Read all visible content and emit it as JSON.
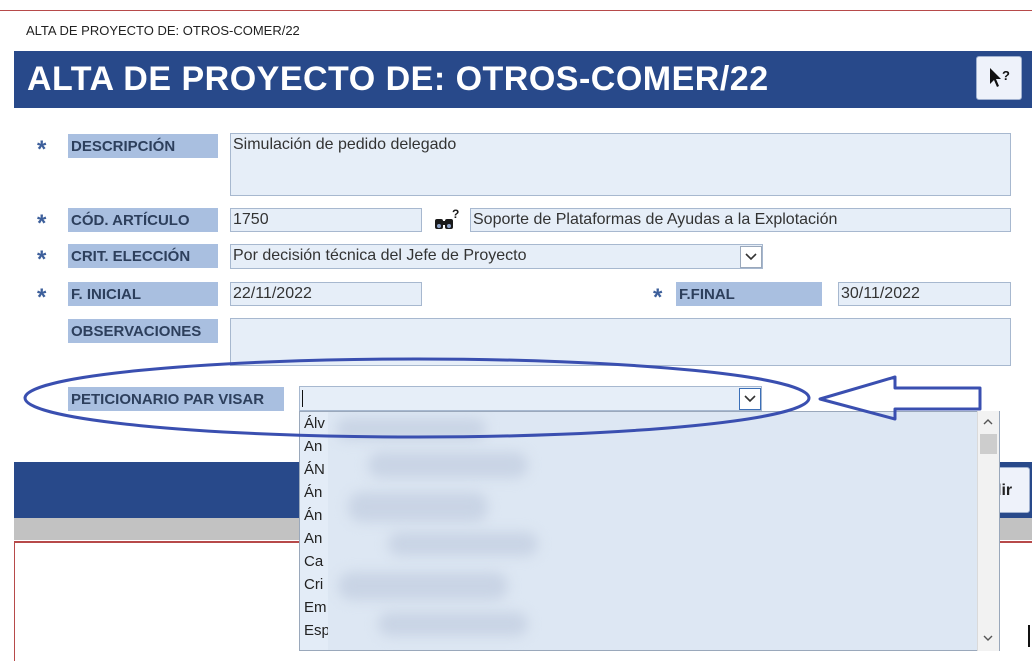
{
  "window": {
    "tab_title": "ALTA DE PROYECTO DE: OTROS-COMER/22"
  },
  "header": {
    "title": "ALTA DE PROYECTO DE: OTROS-COMER/22",
    "help_icon": "pointer-question-icon"
  },
  "form": {
    "required_mark": "*",
    "descripcion": {
      "label": "DESCRIPCIÓN",
      "value": "Simulación de pedido delegado"
    },
    "cod_articulo": {
      "label": "CÓD. ARTÍCULO",
      "value": "1750",
      "lookup_icon": "binoculars-question-icon",
      "description": "Soporte de Plataformas de Ayudas a la Explotación"
    },
    "crit_eleccion": {
      "label": "CRIT. ELECCIÓN",
      "value": "Por decisión técnica del Jefe de Proyecto"
    },
    "f_inicial": {
      "label": "F. INICIAL",
      "value": "22/11/2022"
    },
    "f_final": {
      "label": "F.FINAL",
      "value": "30/11/2022"
    },
    "observaciones": {
      "label": "OBSERVACIONES",
      "value": ""
    },
    "peticionario": {
      "label": "PETICIONARIO PAR VISAR",
      "value": ""
    }
  },
  "dropdown": {
    "items": [
      "Álv",
      "An",
      "ÁN",
      "Án",
      "Án",
      "An",
      "Ca",
      "Cri",
      "Em",
      "Esp"
    ]
  },
  "footer": {
    "exit_label": "lir"
  },
  "colors": {
    "header_bg": "#28498a",
    "label_bg": "#a9bfe0",
    "field_bg": "#e6eef8",
    "annotation": "#3a4fb0"
  }
}
